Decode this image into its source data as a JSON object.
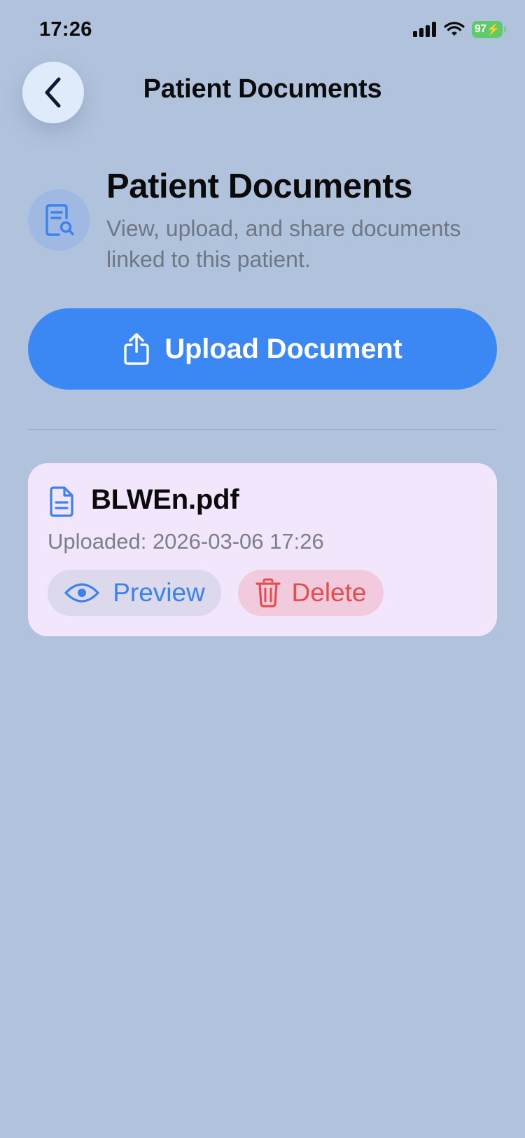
{
  "status_bar": {
    "time": "17:26",
    "battery": "97",
    "icons": [
      "signal-icon",
      "wifi-icon",
      "battery-icon"
    ]
  },
  "nav": {
    "title": "Patient Documents",
    "back_icon": "chevron-left-icon"
  },
  "header": {
    "icon": "document-search-icon",
    "title": "Patient Documents",
    "subtitle": "View, upload, and share documents linked to this patient."
  },
  "upload": {
    "icon": "share-upload-icon",
    "label": "Upload Document"
  },
  "documents": [
    {
      "icon": "file-text-icon",
      "name": "BLWEn.pdf",
      "uploaded": "Uploaded: 2026-03-06 17:26",
      "preview_label": "Preview",
      "preview_icon": "eye-icon",
      "delete_label": "Delete",
      "delete_icon": "trash-icon"
    }
  ],
  "colors": {
    "background": "#b1c3dc",
    "accent": "#3b88f4",
    "card": "#f1e6fb",
    "danger": "#e84b4b",
    "secondary_text": "#6f7684"
  }
}
